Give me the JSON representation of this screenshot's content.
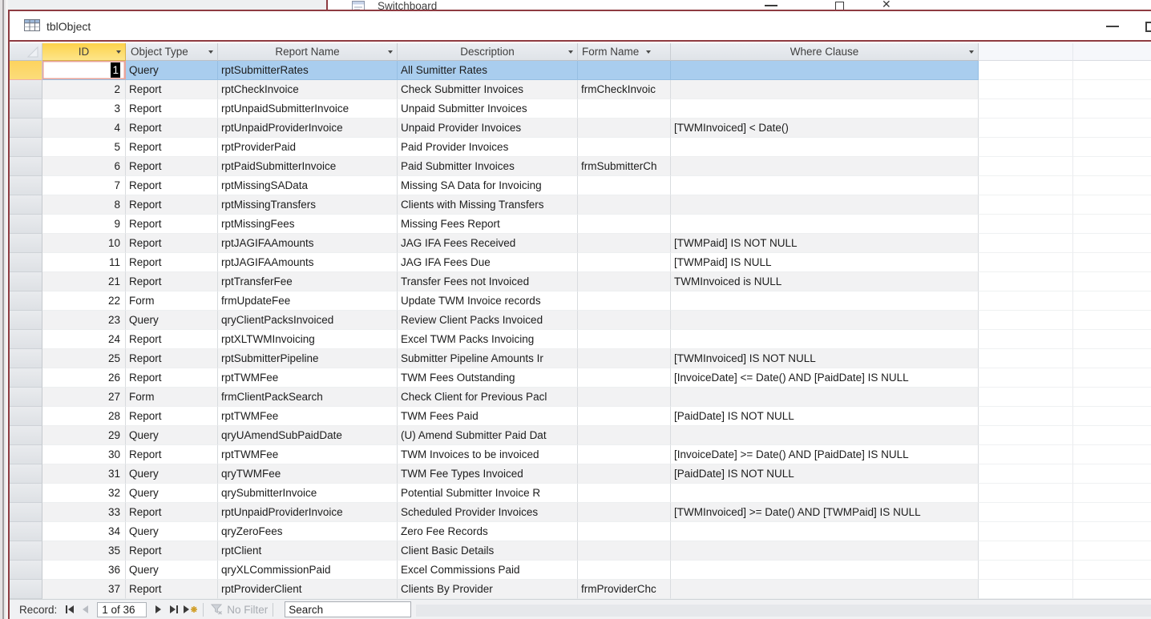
{
  "colors": {
    "window_border": "#8e3b41",
    "selected_row": "#a9cdee",
    "selected_column_header": "#fdd24b",
    "current_row_selector": "#fdd35e",
    "alt_row": "#f2f2f3",
    "active_cell_border": "#e8a39a"
  },
  "background_window": {
    "title": "Switchboard"
  },
  "window": {
    "title": "tblObject"
  },
  "table": {
    "columns": [
      {
        "key": "id",
        "label": "ID",
        "selected": true
      },
      {
        "key": "object_type",
        "label": "Object Type",
        "selected": false
      },
      {
        "key": "report_name",
        "label": "Report Name",
        "selected": false
      },
      {
        "key": "description",
        "label": "Description",
        "selected": false
      },
      {
        "key": "form_name",
        "label": "Form Name",
        "selected": false
      },
      {
        "key": "where_clause",
        "label": "Where Clause",
        "selected": false
      }
    ],
    "selected_row_index": 0,
    "active_cell": {
      "row": 0,
      "column": "id",
      "value": "1"
    },
    "rows": [
      {
        "id": "1",
        "object_type": "Query",
        "report_name": "rptSubmitterRates",
        "description": "All Sumitter Rates",
        "form_name": "",
        "where_clause": ""
      },
      {
        "id": "2",
        "object_type": "Report",
        "report_name": "rptCheckInvoice",
        "description": "Check Submitter Invoices",
        "form_name": "frmCheckInvoic",
        "where_clause": ""
      },
      {
        "id": "3",
        "object_type": "Report",
        "report_name": "rptUnpaidSubmitterInvoice",
        "description": "Unpaid Submitter Invoices",
        "form_name": "",
        "where_clause": ""
      },
      {
        "id": "4",
        "object_type": "Report",
        "report_name": "rptUnpaidProviderInvoice",
        "description": "Unpaid Provider Invoices",
        "form_name": "",
        "where_clause": "[TWMInvoiced] < Date()"
      },
      {
        "id": "5",
        "object_type": "Report",
        "report_name": "rptProviderPaid",
        "description": "Paid Provider Invoices",
        "form_name": "",
        "where_clause": ""
      },
      {
        "id": "6",
        "object_type": "Report",
        "report_name": "rptPaidSubmitterInvoice",
        "description": "Paid Submitter Invoices",
        "form_name": "frmSubmitterCh",
        "where_clause": ""
      },
      {
        "id": "7",
        "object_type": "Report",
        "report_name": "rptMissingSAData",
        "description": "Missing SA Data for Invoicing",
        "form_name": "",
        "where_clause": ""
      },
      {
        "id": "8",
        "object_type": "Report",
        "report_name": "rptMissingTransfers",
        "description": "Clients with Missing Transfers",
        "form_name": "",
        "where_clause": ""
      },
      {
        "id": "9",
        "object_type": "Report",
        "report_name": "rptMissingFees",
        "description": "Missing Fees Report",
        "form_name": "",
        "where_clause": ""
      },
      {
        "id": "10",
        "object_type": "Report",
        "report_name": "rptJAGIFAAmounts",
        "description": "JAG IFA Fees Received",
        "form_name": "",
        "where_clause": "[TWMPaid] IS NOT NULL"
      },
      {
        "id": "11",
        "object_type": "Report",
        "report_name": "rptJAGIFAAmounts",
        "description": "JAG IFA Fees Due",
        "form_name": "",
        "where_clause": "[TWMPaid] IS NULL"
      },
      {
        "id": "21",
        "object_type": "Report",
        "report_name": "rptTransferFee",
        "description": "Transfer Fees not Invoiced",
        "form_name": "",
        "where_clause": "TWMInvoiced is NULL"
      },
      {
        "id": "22",
        "object_type": "Form",
        "report_name": "frmUpdateFee",
        "description": "Update TWM Invoice records",
        "form_name": "",
        "where_clause": ""
      },
      {
        "id": "23",
        "object_type": "Query",
        "report_name": "qryClientPacksInvoiced",
        "description": "Review Client Packs Invoiced",
        "form_name": "",
        "where_clause": ""
      },
      {
        "id": "24",
        "object_type": "Report",
        "report_name": "rptXLTWMInvoicing",
        "description": "Excel TWM Packs Invoicing",
        "form_name": "",
        "where_clause": ""
      },
      {
        "id": "25",
        "object_type": "Report",
        "report_name": "rptSubmitterPipeline",
        "description": "Submitter Pipeline Amounts Ir",
        "form_name": "",
        "where_clause": "[TWMInvoiced] IS NOT NULL"
      },
      {
        "id": "26",
        "object_type": "Report",
        "report_name": "rptTWMFee",
        "description": "TWM Fees Outstanding",
        "form_name": "",
        "where_clause": "[InvoiceDate] <= Date() AND [PaidDate] IS NULL"
      },
      {
        "id": "27",
        "object_type": "Form",
        "report_name": "frmClientPackSearch",
        "description": "Check Client for Previous Pacl",
        "form_name": "",
        "where_clause": ""
      },
      {
        "id": "28",
        "object_type": "Report",
        "report_name": "rptTWMFee",
        "description": "TWM Fees Paid",
        "form_name": "",
        "where_clause": "[PaidDate] IS NOT NULL"
      },
      {
        "id": "29",
        "object_type": "Query",
        "report_name": "qryUAmendSubPaidDate",
        "description": "(U) Amend Submitter Paid Dat",
        "form_name": "",
        "where_clause": ""
      },
      {
        "id": "30",
        "object_type": "Report",
        "report_name": "rptTWMFee",
        "description": "TWM Invoices to be invoiced",
        "form_name": "",
        "where_clause": "[InvoiceDate] >= Date() AND [PaidDate] IS NULL"
      },
      {
        "id": "31",
        "object_type": "Query",
        "report_name": "qryTWMFee",
        "description": "TWM Fee Types Invoiced",
        "form_name": "",
        "where_clause": "[PaidDate] IS NOT NULL"
      },
      {
        "id": "32",
        "object_type": "Query",
        "report_name": "qrySubmitterInvoice",
        "description": "Potential Submitter Invoice R",
        "form_name": "",
        "where_clause": ""
      },
      {
        "id": "33",
        "object_type": "Report",
        "report_name": "rptUnpaidProviderInvoice",
        "description": "Scheduled Provider Invoices",
        "form_name": "",
        "where_clause": "[TWMInvoiced] >= Date() AND [TWMPaid] IS NULL"
      },
      {
        "id": "34",
        "object_type": "Query",
        "report_name": "qryZeroFees",
        "description": "Zero Fee Records",
        "form_name": "",
        "where_clause": ""
      },
      {
        "id": "35",
        "object_type": "Report",
        "report_name": "rptClient",
        "description": "Client Basic Details",
        "form_name": "",
        "where_clause": ""
      },
      {
        "id": "36",
        "object_type": "Query",
        "report_name": "qryXLCommissionPaid",
        "description": "Excel Commissions Paid",
        "form_name": "",
        "where_clause": ""
      },
      {
        "id": "37",
        "object_type": "Report",
        "report_name": "rptProviderClient",
        "description": "Clients By Provider",
        "form_name": "frmProviderChc",
        "where_clause": ""
      }
    ]
  },
  "record_navigation": {
    "label": "Record:",
    "position": "1 of 36",
    "no_filter_label": "No Filter",
    "search_value": "Search"
  }
}
